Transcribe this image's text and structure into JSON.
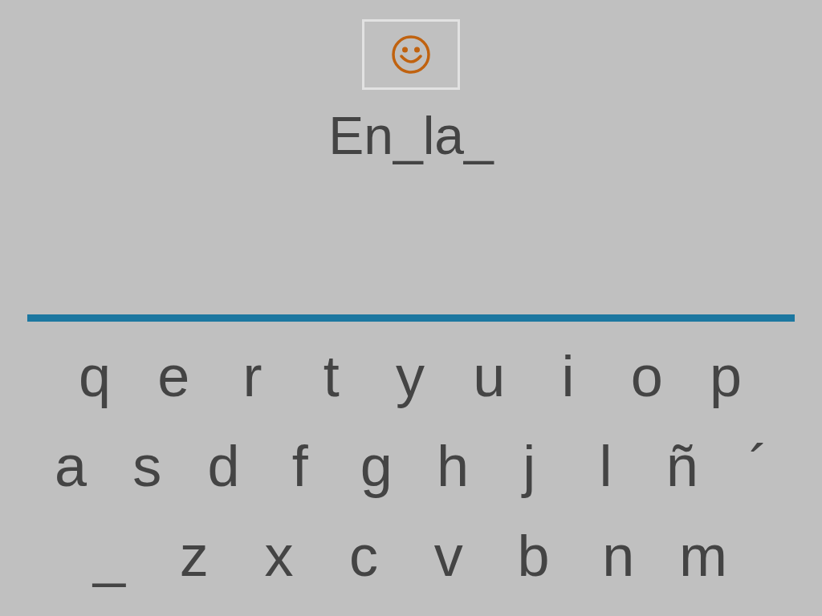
{
  "answer": {
    "text": "En_la_"
  },
  "keyboard": {
    "rows": [
      {
        "keys": [
          "q",
          "e",
          "r",
          "t",
          "y",
          "u",
          "i",
          "o",
          "p"
        ]
      },
      {
        "keys": [
          "a",
          "s",
          "d",
          "f",
          "g",
          "h",
          "j",
          "l",
          "ñ",
          "´"
        ]
      },
      {
        "keys": [
          "_",
          "z",
          "x",
          "c",
          "v",
          "b",
          "n",
          "m"
        ]
      }
    ]
  }
}
